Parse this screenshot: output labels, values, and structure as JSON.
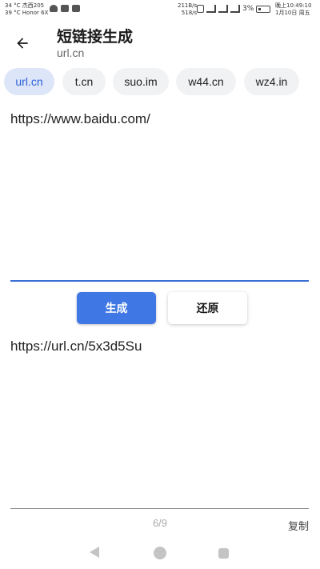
{
  "status_bar": {
    "left_line1": "34 °C 杰西205",
    "left_line2": "39 °C Honor 6X",
    "speed_line1": "211B/s",
    "speed_line2": "518/s",
    "battery": "3%",
    "time": "晚上10:49:10",
    "date": "1月10日 周五"
  },
  "header": {
    "title": "短链接生成",
    "subtitle": "url.cn"
  },
  "chips": [
    {
      "label": "url.cn",
      "selected": true
    },
    {
      "label": "t.cn",
      "selected": false
    },
    {
      "label": "suo.im",
      "selected": false
    },
    {
      "label": "w44.cn",
      "selected": false
    },
    {
      "label": "wz4.in",
      "selected": false
    }
  ],
  "input": {
    "value": "https://www.baidu.com/"
  },
  "buttons": {
    "generate": "生成",
    "restore": "还原"
  },
  "result": {
    "value": "https://url.cn/5x3d5Su"
  },
  "footer": {
    "pager": "6/9",
    "copy": "复制"
  },
  "colors": {
    "accent": "#3f78e4",
    "chip_selected_bg": "#dde6f8",
    "chip_bg": "#f1f2f4"
  }
}
